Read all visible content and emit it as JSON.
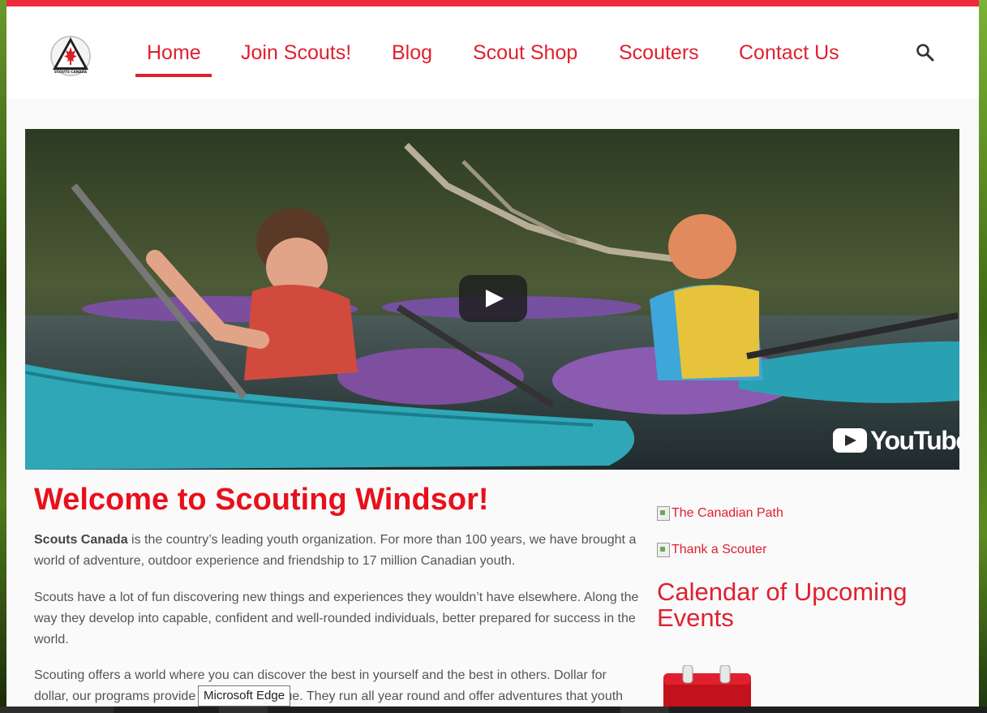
{
  "nav": {
    "items": [
      {
        "label": "Home",
        "active": true
      },
      {
        "label": "Join Scouts!",
        "active": false
      },
      {
        "label": "Blog",
        "active": false
      },
      {
        "label": "Scout Shop",
        "active": false
      },
      {
        "label": "Scouters",
        "active": false
      },
      {
        "label": "Contact Us",
        "active": false
      }
    ],
    "search_icon": "search-icon",
    "logo_text": "SCOUTS CANADA"
  },
  "video": {
    "play_icon": "play-icon",
    "youtube_label": "YouTube"
  },
  "main": {
    "title": "Welcome to Scouting Windsor!",
    "p1_bold": "Scouts Canada",
    "p1_rest": " is the country’s leading youth organization. For more than 100 years, we have brought a world of adventure, outdoor experience and friendship to 17 million Canadian youth.",
    "p2": "Scouts have a lot of fun discovering new things and experiences they wouldn’t have elsewhere. Along the way they develop into capable, confident and well-rounded individuals, better prepared for success in the world.",
    "p3": "Scouting offers a world where you can discover the best in yourself and the best in others. Dollar for dollar, our programs provide exceptional value. They run all year round and offer adventures that youth"
  },
  "tooltip": "Microsoft Edge",
  "sidebar": {
    "link1_alt": "The Canadian Path",
    "link2_alt": "Thank a Scouter",
    "calendar_title": "Calendar of Upcoming Events",
    "calendar_icon": "calendar-icon"
  },
  "colors": {
    "brand_red": "#e0202f",
    "top_bar": "#ee2b3b",
    "title_red": "#e8101c"
  }
}
